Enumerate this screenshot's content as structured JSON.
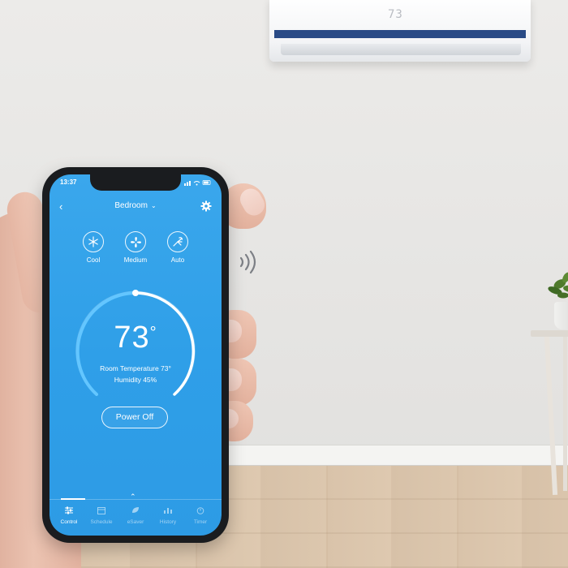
{
  "ac": {
    "display": "73"
  },
  "phone": {
    "status_time": "13:37",
    "header": {
      "room": "Bedroom"
    },
    "modes": [
      {
        "label": "Cool",
        "icon": "snowflake-icon"
      },
      {
        "label": "Medium",
        "icon": "fan-icon"
      },
      {
        "label": "Auto",
        "icon": "swing-icon"
      }
    ],
    "thermostat": {
      "set_temp": "73",
      "degree": "°",
      "room_temperature": "Room Temperature 73°",
      "humidity": "Humidity 45%"
    },
    "power_button": "Power Off",
    "tabs": [
      {
        "label": "Control",
        "active": true,
        "icon": "sliders-icon"
      },
      {
        "label": "Schedule",
        "active": false,
        "icon": "calendar-icon"
      },
      {
        "label": "eSaver",
        "active": false,
        "icon": "leaf-icon"
      },
      {
        "label": "History",
        "active": false,
        "icon": "chart-icon"
      },
      {
        "label": "Timer",
        "active": false,
        "icon": "timer-icon"
      }
    ]
  },
  "colors": {
    "screen_blue": "#2f9fe8",
    "ac_stripe": "#2a4b86"
  }
}
